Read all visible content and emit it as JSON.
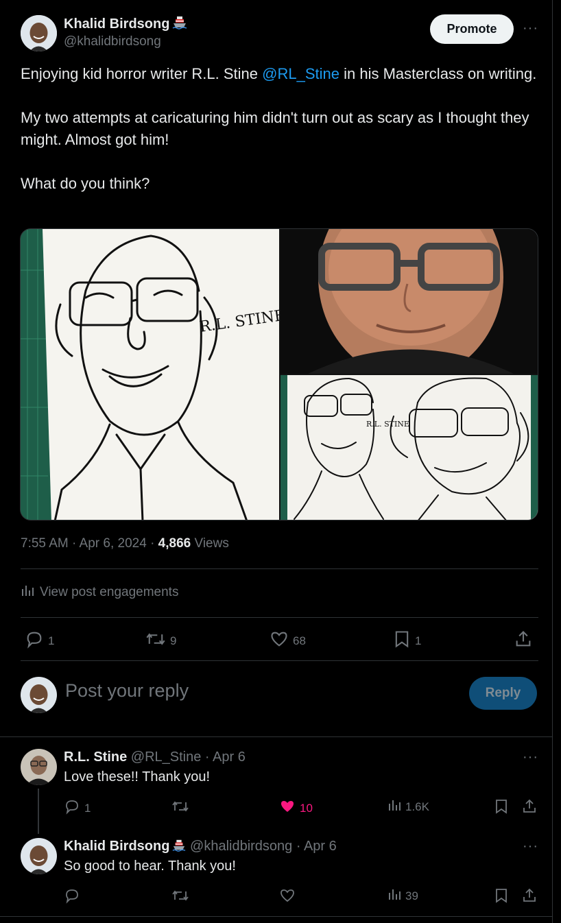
{
  "post": {
    "author_name": "Khalid Birdsong",
    "author_handle": "@khalidbirdsong",
    "promote_label": "Promote",
    "more_label": "···",
    "text_before_mention": "Enjoying kid horror writer R.L. Stine ",
    "mention": "@RL_Stine",
    "text_after_mention": " in his Masterclass on writing.",
    "paragraph2": "My two attempts at caricaturing him didn't turn out as scary as I thought they might. Almost got him!",
    "paragraph3": "What do you think?",
    "caricature_signature": "R.L. STINE",
    "time": "7:55 AM · Apr 6, 2024 · ",
    "views_count": "4,866",
    "views_label": " Views",
    "engagements_label": "View post engagements",
    "actions": {
      "replies": "1",
      "reposts": "9",
      "likes": "68",
      "bookmarks": "1"
    }
  },
  "composer": {
    "placeholder": "Post your reply",
    "reply_label": "Reply"
  },
  "replies": [
    {
      "name": "R.L. Stine",
      "handle": "@RL_Stine",
      "date": " · Apr 6",
      "text": "Love these!! Thank you!",
      "replies": "1",
      "reposts": "",
      "likes": "10",
      "views": "1.6K",
      "more_label": "···"
    },
    {
      "name": "Khalid Birdsong",
      "handle": "@khalidbirdsong",
      "date": " · Apr 6",
      "text": "So good to hear. Thank you!",
      "replies": "",
      "reposts": "",
      "likes": "",
      "views": "39",
      "more_label": "···"
    }
  ],
  "colors": {
    "background": "#000000",
    "text": "#e7e9ea",
    "muted": "#71767b",
    "link": "#1d9bf0",
    "like_active": "#f91880",
    "reply_button_bg": "#0f4e78"
  }
}
